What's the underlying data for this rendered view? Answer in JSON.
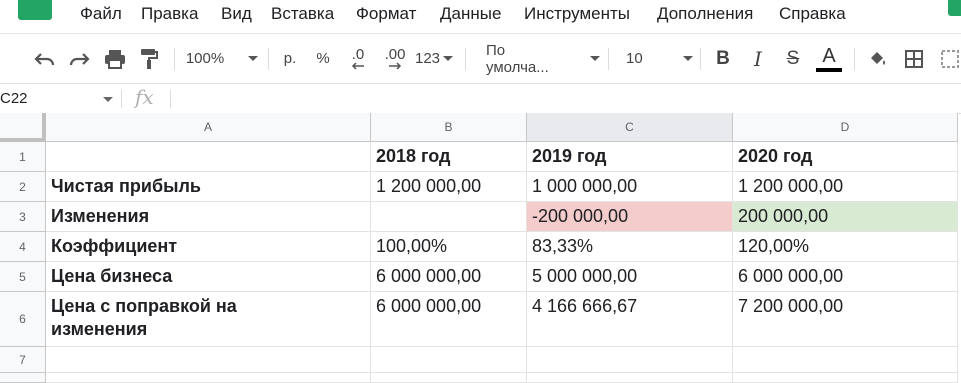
{
  "menu": [
    "Файл",
    "Правка",
    "Вид",
    "Вставка",
    "Формат",
    "Данные",
    "Инструменты",
    "Дополнения",
    "Справка"
  ],
  "toolbar": {
    "zoom": "100%",
    "currency": "р.",
    "percent": "%",
    "decrease_decimals": ".0",
    "increase_decimals": ".00",
    "number_format": "123",
    "font": "По умолча...",
    "font_size": "10",
    "bold": "B",
    "italic": "I",
    "strikethrough": "S",
    "text_color": "A",
    "text_color_value": "#000000"
  },
  "formula_bar": {
    "cell_ref": "C22",
    "fx": "fx",
    "value": ""
  },
  "columns": [
    "A",
    "B",
    "C",
    "D"
  ],
  "rows": [
    "1",
    "2",
    "3",
    "4",
    "5",
    "6",
    "7"
  ],
  "cells": {
    "r1": {
      "a": "",
      "b": "2018 год",
      "c": "2019 год",
      "d": "2020 год"
    },
    "r2": {
      "a": "Чистая прибыль",
      "b": "1 200 000,00",
      "c": "1 000 000,00",
      "d": "1 200 000,00"
    },
    "r3": {
      "a": "Изменения",
      "b": "",
      "c": "-200 000,00",
      "d": "200 000,00"
    },
    "r4": {
      "a": "Коэффициент",
      "b": "100,00%",
      "c": "83,33%",
      "d": "120,00%"
    },
    "r5": {
      "a": "Цена бизнеса",
      "b": "6 000 000,00",
      "c": "5 000 000,00",
      "d": "6 000 000,00"
    },
    "r6": {
      "a": "Цена с поправкой на изменения",
      "b": "6 000 000,00",
      "c": "4 166 666,67",
      "d": "7 200 000,00"
    },
    "r7": {
      "a": "",
      "b": "",
      "c": "",
      "d": ""
    }
  },
  "colors": {
    "negative_fill": "#f4cccc",
    "positive_fill": "#d9ead3",
    "brand": "#23a566"
  }
}
